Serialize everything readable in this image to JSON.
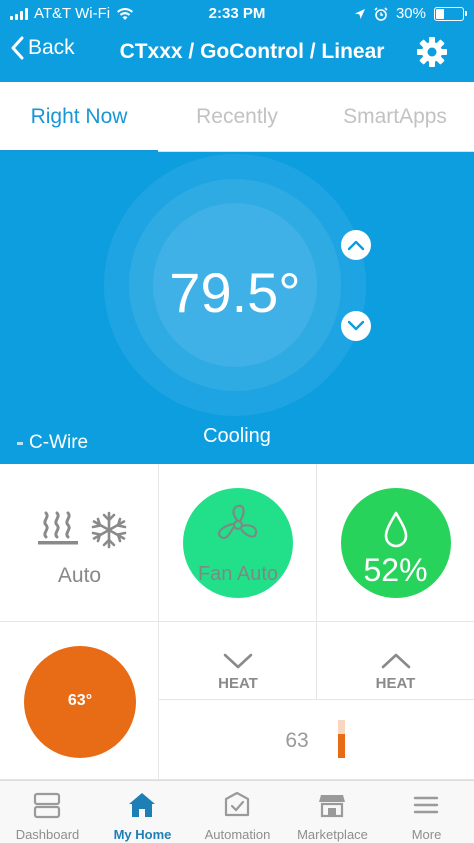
{
  "status": {
    "carrier": "AT&T Wi-Fi",
    "time": "2:33 PM",
    "battery": "30%",
    "battery_level": 0.3
  },
  "nav": {
    "back_label": "Back",
    "title": "CTxxx / GoControl / Linear"
  },
  "tabs": [
    {
      "label": "Right Now",
      "active": true
    },
    {
      "label": "Recently",
      "active": false
    },
    {
      "label": "SmartApps",
      "active": false
    }
  ],
  "thermostat": {
    "temperature": "79.5°",
    "state": "Cooling",
    "power": "C-Wire"
  },
  "tiles": {
    "mode_label": "Auto",
    "fan_label": "Fan Auto",
    "humidity": "52%",
    "heat_setpoint": "63°",
    "heat_down_label": "HEAT",
    "heat_up_label": "HEAT",
    "slider_value": "63"
  },
  "colors": {
    "brand_blue": "#0d9ee0",
    "fan_green": "#22e08a",
    "humidity_green": "#28d35c",
    "heat_orange": "#e86b15"
  },
  "tabbar": [
    {
      "label": "Dashboard",
      "icon": "dashboard-icon",
      "active": false
    },
    {
      "label": "My Home",
      "icon": "home-icon",
      "active": true
    },
    {
      "label": "Automation",
      "icon": "automation-icon",
      "active": false
    },
    {
      "label": "Marketplace",
      "icon": "marketplace-icon",
      "active": false
    },
    {
      "label": "More",
      "icon": "menu-icon",
      "active": false
    }
  ]
}
